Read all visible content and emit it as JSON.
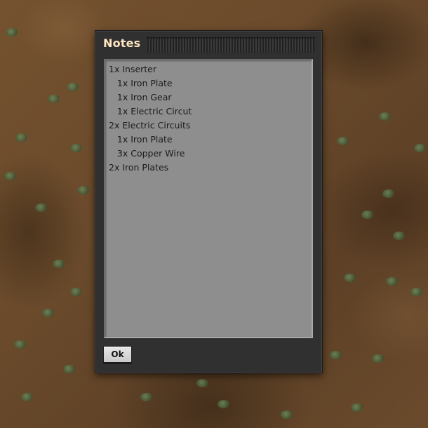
{
  "window": {
    "title": "Notes",
    "notes_lines": [
      "1x Inserter",
      "   1x Iron Plate",
      "   1x Iron Gear",
      "   1x Electric Circut",
      "2x Electric Circuits",
      "   1x Iron Plate",
      "   3x Copper Wire",
      "2x Iron Plates"
    ],
    "ok_label": "Ok"
  }
}
